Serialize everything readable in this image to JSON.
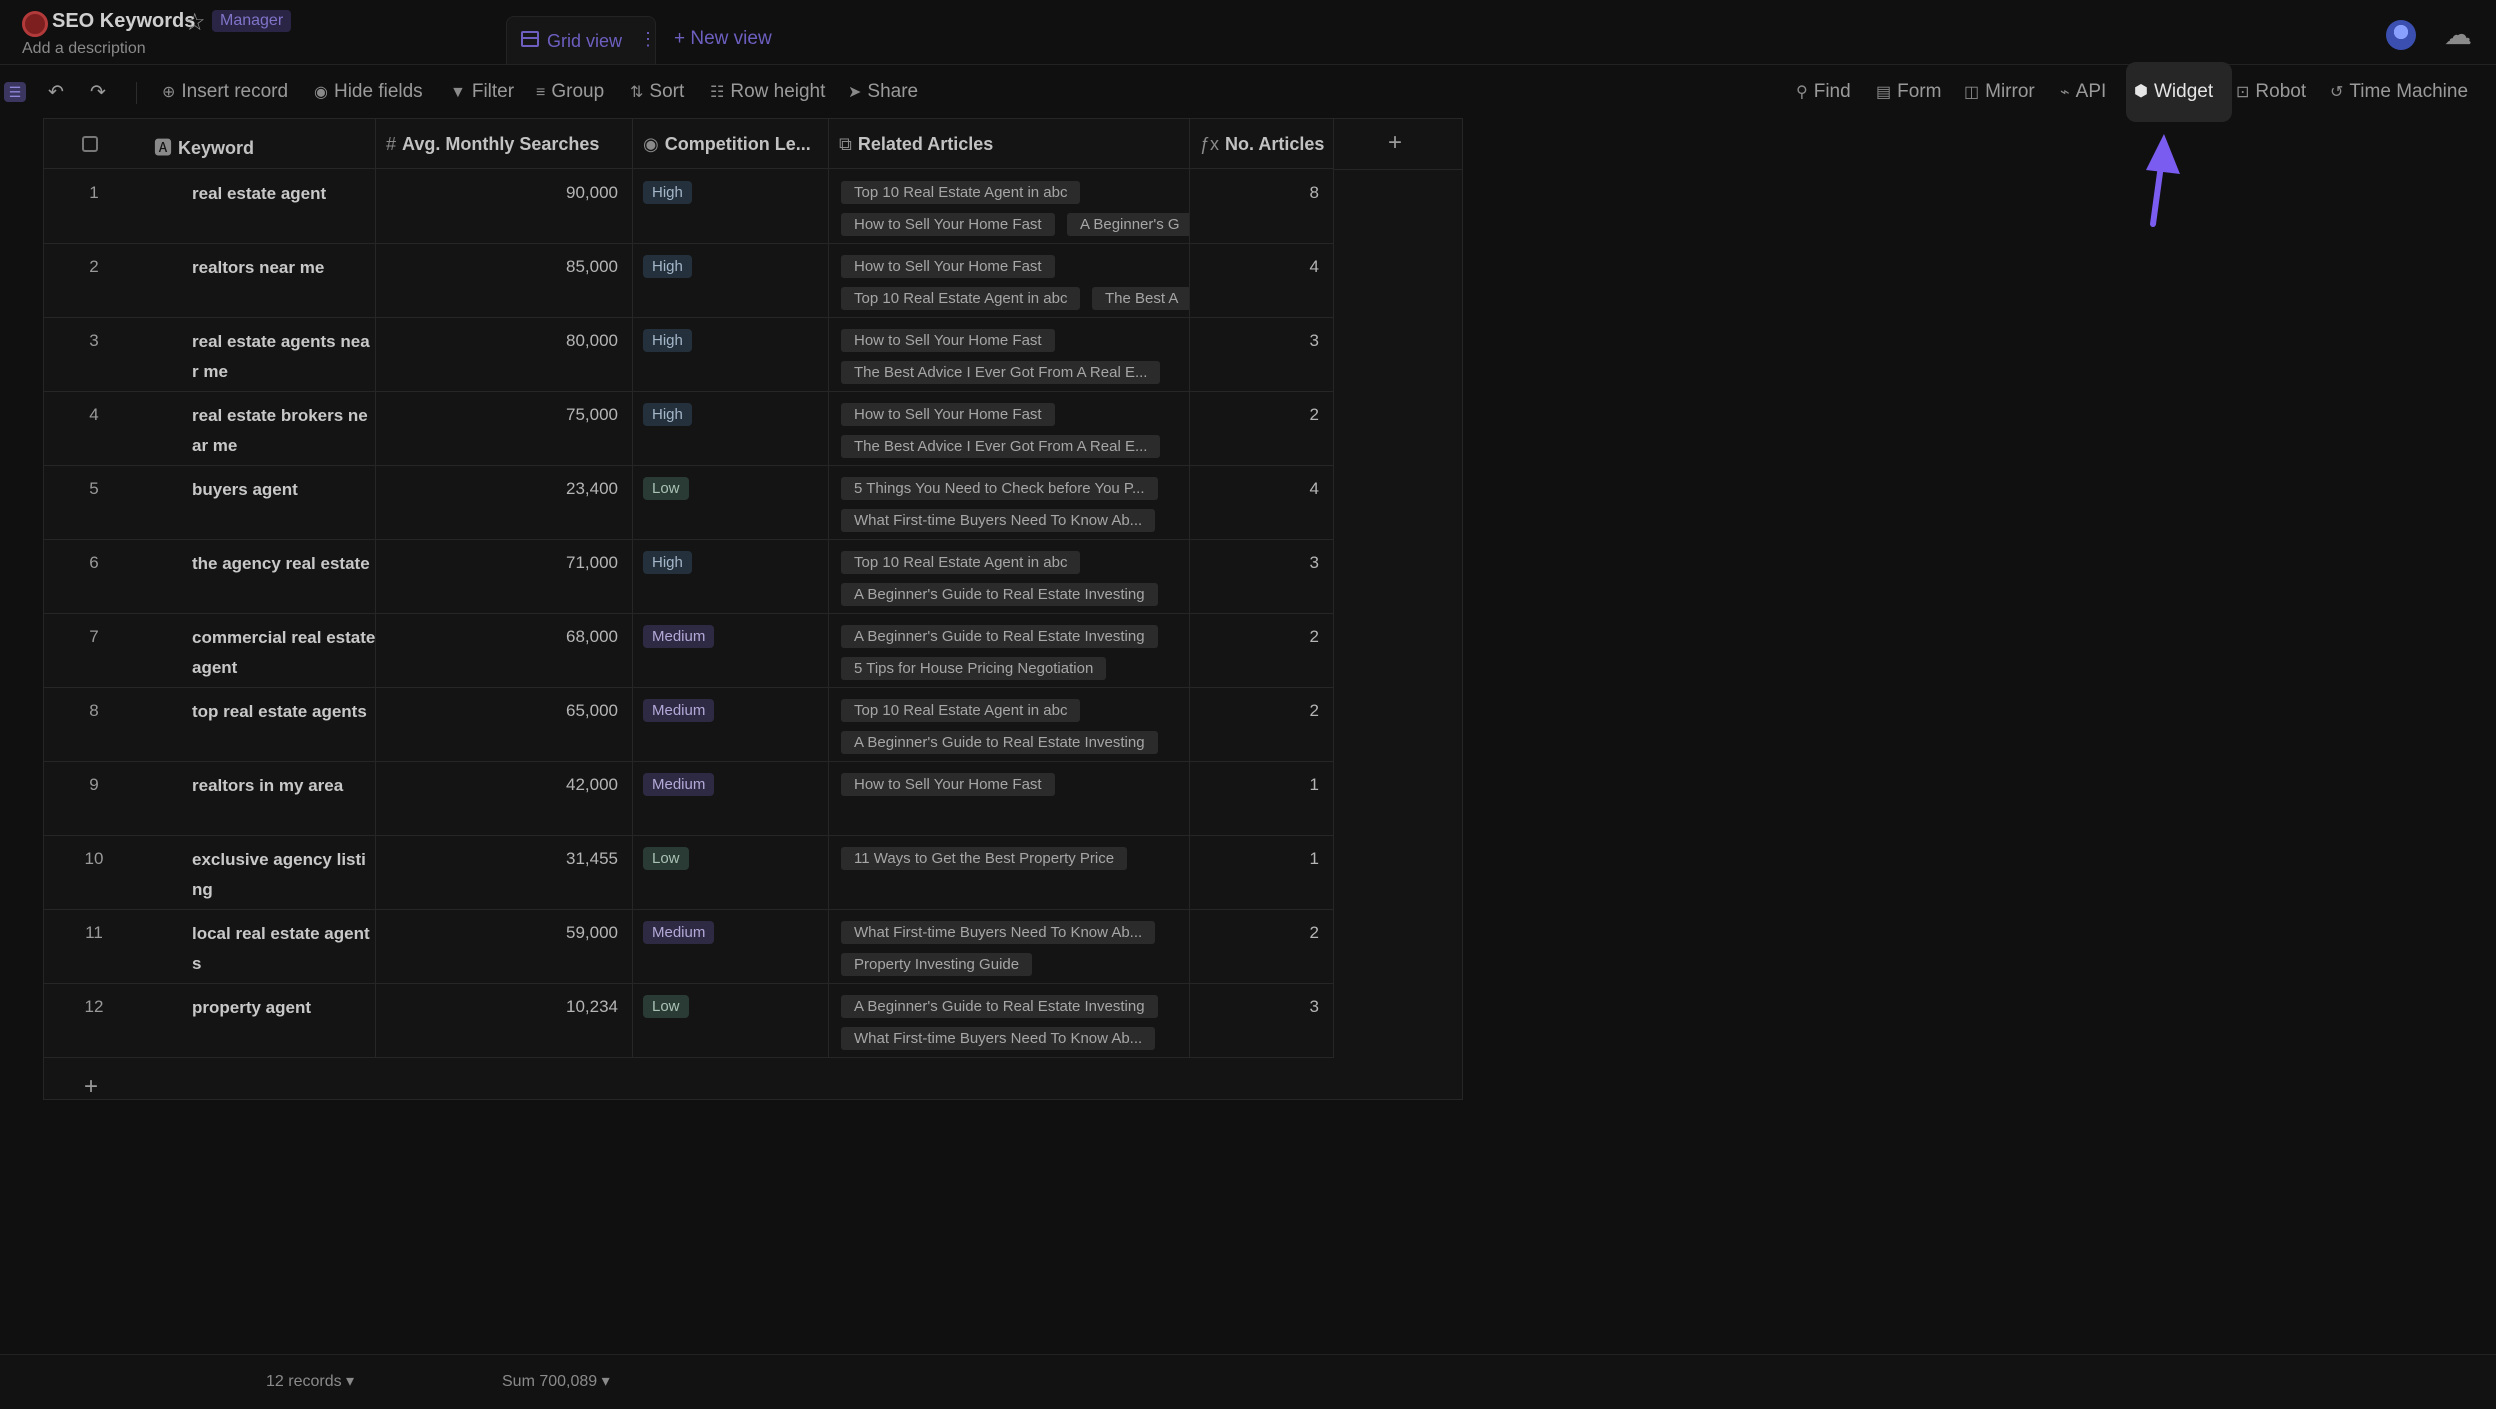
{
  "header": {
    "title": "SEO Keywords",
    "role_badge": "Manager",
    "description": "Add a description",
    "active_tab": "Grid view",
    "new_view": "+ New view"
  },
  "toolbar": {
    "insert_record": "Insert record",
    "hide_fields": "Hide fields",
    "filter": "Filter",
    "group": "Group",
    "sort": "Sort",
    "row_height": "Row height",
    "share": "Share",
    "find": "Find",
    "form": "Form",
    "mirror": "Mirror",
    "api": "API",
    "widget": "Widget",
    "robot": "Robot",
    "time_machine": "Time Machine"
  },
  "columns": {
    "keyword": "Keyword",
    "avg": "Avg. Monthly Searches",
    "competition": "Competition Le...",
    "related": "Related Articles",
    "no_articles": "No. Articles"
  },
  "rows": [
    {
      "num": "1",
      "keyword": "real estate agent",
      "avg": "90,000",
      "comp": "High",
      "articles": [
        "Top 10 Real Estate Agent in abc",
        "How to Sell Your Home Fast",
        "A Beginner's G"
      ],
      "count": "8"
    },
    {
      "num": "2",
      "keyword": "realtors near me",
      "avg": "85,000",
      "comp": "High",
      "articles": [
        "How to Sell Your Home Fast",
        "Top 10 Real Estate Agent in abc",
        "The Best A"
      ],
      "count": "4"
    },
    {
      "num": "3",
      "keyword": "real estate agents near me",
      "avg": "80,000",
      "comp": "High",
      "articles": [
        "How to Sell Your Home Fast",
        "The Best Advice I Ever Got From A Real E..."
      ],
      "count": "3"
    },
    {
      "num": "4",
      "keyword": "real estate brokers near me",
      "avg": "75,000",
      "comp": "High",
      "articles": [
        "How to Sell Your Home Fast",
        "The Best Advice I Ever Got From A Real E..."
      ],
      "count": "2"
    },
    {
      "num": "5",
      "keyword": "buyers agent",
      "avg": "23,400",
      "comp": "Low",
      "articles": [
        "5 Things You Need to Check before You P...",
        "What First-time Buyers Need To Know Ab..."
      ],
      "count": "4"
    },
    {
      "num": "6",
      "keyword": "the agency real estate",
      "avg": "71,000",
      "comp": "High",
      "articles": [
        "Top 10 Real Estate Agent in abc",
        "A Beginner's Guide to Real Estate Investing"
      ],
      "count": "3"
    },
    {
      "num": "7",
      "keyword": "commercial real estate agent",
      "avg": "68,000",
      "comp": "Medium",
      "articles": [
        "A Beginner's Guide to Real Estate Investing",
        "5 Tips for House Pricing Negotiation"
      ],
      "count": "2"
    },
    {
      "num": "8",
      "keyword": "top real estate agents",
      "avg": "65,000",
      "comp": "Medium",
      "articles": [
        "Top 10 Real Estate Agent in abc",
        "A Beginner's Guide to Real Estate Investing"
      ],
      "count": "2"
    },
    {
      "num": "9",
      "keyword": "realtors in my area",
      "avg": "42,000",
      "comp": "Medium",
      "articles": [
        "How to Sell Your Home Fast"
      ],
      "count": "1"
    },
    {
      "num": "10",
      "keyword": "exclusive agency listing",
      "avg": "31,455",
      "comp": "Low",
      "articles": [
        "11 Ways to Get the Best Property Price"
      ],
      "count": "1"
    },
    {
      "num": "11",
      "keyword": "local real estate agents",
      "avg": "59,000",
      "comp": "Medium",
      "articles": [
        "What First-time Buyers Need To Know Ab...",
        "Property Investing Guide"
      ],
      "count": "2"
    },
    {
      "num": "12",
      "keyword": "property agent",
      "avg": "10,234",
      "comp": "Low",
      "articles": [
        "A Beginner's Guide to Real Estate Investing",
        "What First-time Buyers Need To Know Ab..."
      ],
      "count": "3"
    }
  ],
  "footer": {
    "records": "12 records ▾",
    "sum": "Sum 700,089 ▾"
  }
}
